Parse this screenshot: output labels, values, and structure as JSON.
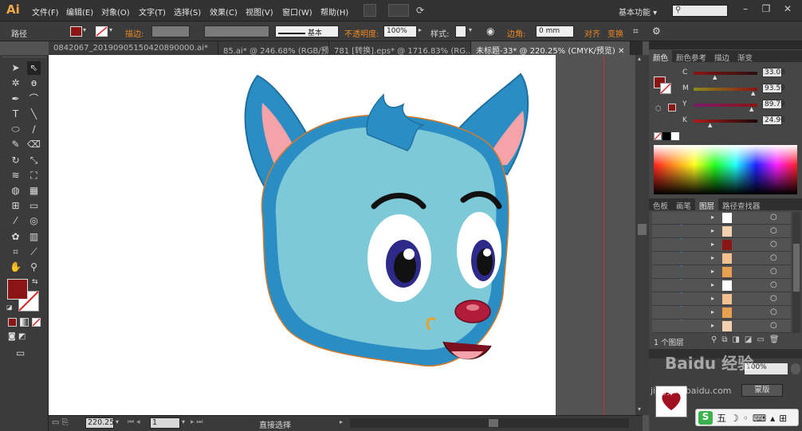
{
  "app": {
    "logo": "Ai"
  },
  "menu": [
    "文件(F)",
    "编辑(E)",
    "对象(O)",
    "文字(T)",
    "选择(S)",
    "效果(C)",
    "视图(V)",
    "窗口(W)",
    "帮助(H)"
  ],
  "workspace": "基本功能",
  "control": {
    "selection_label": "路径",
    "stroke_label": "描边:",
    "stroke_style": "基本",
    "opacity_label": "不透明度:",
    "opacity_value": "100%",
    "style_label": "样式:",
    "corner_label": "边角:",
    "corner_value": "0 mm",
    "align_label": "对齐",
    "transform_label": "变换"
  },
  "tabs": [
    {
      "label": "0842067_20190905150420890000.ai*",
      "active": false
    },
    {
      "label": "85.ai* @ 246.68% (RGB/预...",
      "active": false
    },
    {
      "label": "781 [转换].eps* @ 1716.83% (RG...",
      "active": false
    },
    {
      "label": "未标题-33* @ 220.25% (CMYK/预览)",
      "active": true
    }
  ],
  "status": {
    "zoom": "220.25",
    "page": "1",
    "tool_name": "直接选择"
  },
  "color_panel": {
    "tabs": [
      "颜色",
      "颜色参考",
      "描边",
      "渐变"
    ],
    "channels": [
      {
        "name": "C",
        "value": "33.08",
        "color": "#8a2a2a"
      },
      {
        "name": "M",
        "value": "93.59",
        "color": "#8a2a2a"
      },
      {
        "name": "Y",
        "value": "89.79",
        "color": "#8a2a2a"
      },
      {
        "name": "K",
        "value": "24.96",
        "color": "#8a2a2a"
      }
    ],
    "fill_color": "#8b1414"
  },
  "layers_panel": {
    "tabs": [
      "色板",
      "画笔",
      "图层",
      "路径查找器"
    ],
    "count_label": "1 个图层"
  },
  "watermark": {
    "text": "Baidu 经验",
    "url": "jingyan.baidu.com"
  },
  "bottom_panel": {
    "opacity_value": "100%",
    "mask_label": "蒙版"
  }
}
